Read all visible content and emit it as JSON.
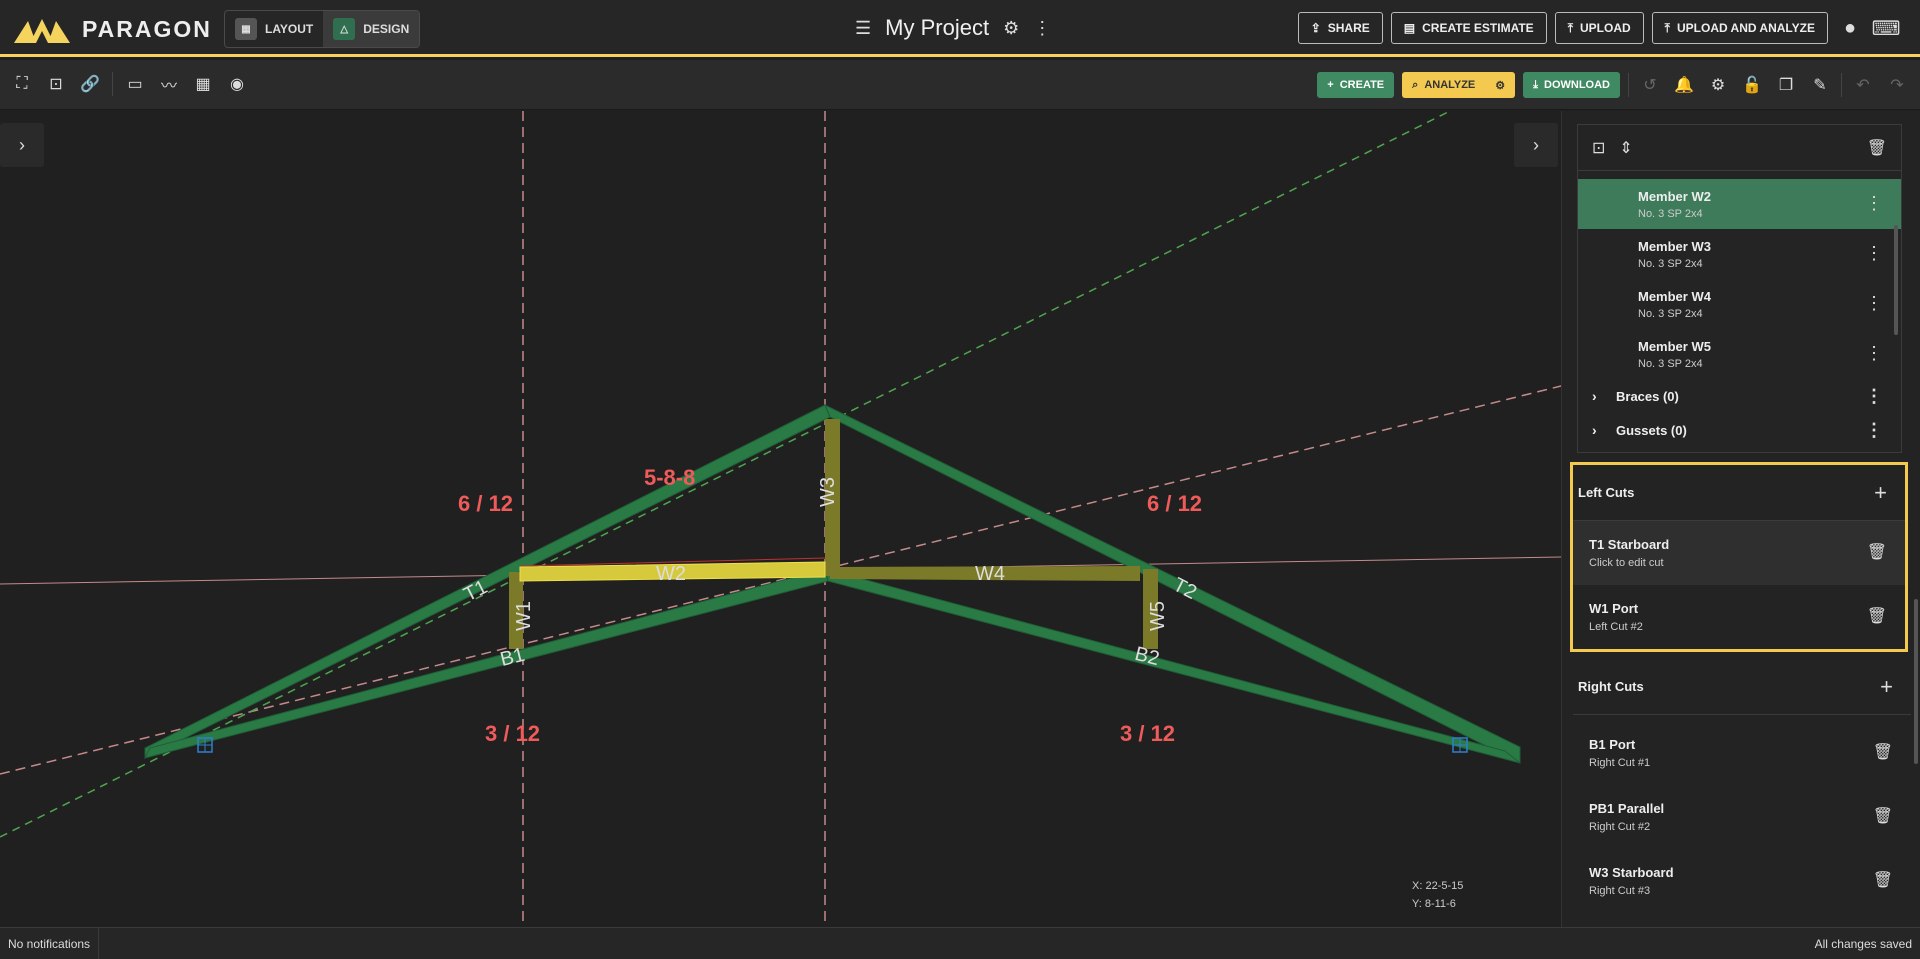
{
  "app": {
    "name": "PARAGON",
    "brand_color": "#f5d45e"
  },
  "mode": {
    "layout": "LAYOUT",
    "design": "DESIGN",
    "active": "DESIGN"
  },
  "project": {
    "title": "My Project"
  },
  "top_actions": {
    "share": "SHARE",
    "estimate": "CREATE ESTIMATE",
    "upload": "UPLOAD",
    "upload_analyze": "UPLOAD AND ANALYZE"
  },
  "toolbar": {
    "create": "CREATE",
    "analyze": "ANALYZE",
    "download": "DOWNLOAD"
  },
  "canvas": {
    "labels": {
      "pitch_left_top": "6 / 12",
      "pitch_right_top": "6 / 12",
      "pitch_left_bottom": "3 / 12",
      "pitch_right_bottom": "3 / 12",
      "dimension": "5-8-8"
    },
    "members": {
      "t1": "T1",
      "t2": "T2",
      "b1": "B1",
      "b2": "B2",
      "w1": "W1",
      "w2": "W2",
      "w3": "W3",
      "w4": "W4",
      "w5": "W5"
    },
    "coords": {
      "x": "X: 22-5-15",
      "y": "Y: 8-11-6"
    }
  },
  "tree": {
    "members": [
      {
        "name": "Member W2",
        "spec": "No. 3 SP 2x4",
        "selected": true
      },
      {
        "name": "Member W3",
        "spec": "No. 3 SP 2x4",
        "selected": false
      },
      {
        "name": "Member W4",
        "spec": "No. 3 SP 2x4",
        "selected": false
      },
      {
        "name": "Member W5",
        "spec": "No. 3 SP 2x4",
        "selected": false
      }
    ],
    "groups": [
      {
        "label": "Braces (0)"
      },
      {
        "label": "Gussets (0)"
      }
    ]
  },
  "left_cuts": {
    "title": "Left Cuts",
    "items": [
      {
        "name": "T1 Starboard",
        "sub": "Click to edit cut"
      },
      {
        "name": "W1 Port",
        "sub": "Left Cut #2"
      }
    ]
  },
  "right_cuts": {
    "title": "Right Cuts",
    "items": [
      {
        "name": "B1 Port",
        "sub": "Right Cut #1"
      },
      {
        "name": "PB1 Parallel",
        "sub": "Right Cut #2"
      },
      {
        "name": "W3 Starboard",
        "sub": "Right Cut #3"
      }
    ]
  },
  "status": {
    "left": "No notifications",
    "right": "All changes saved"
  }
}
